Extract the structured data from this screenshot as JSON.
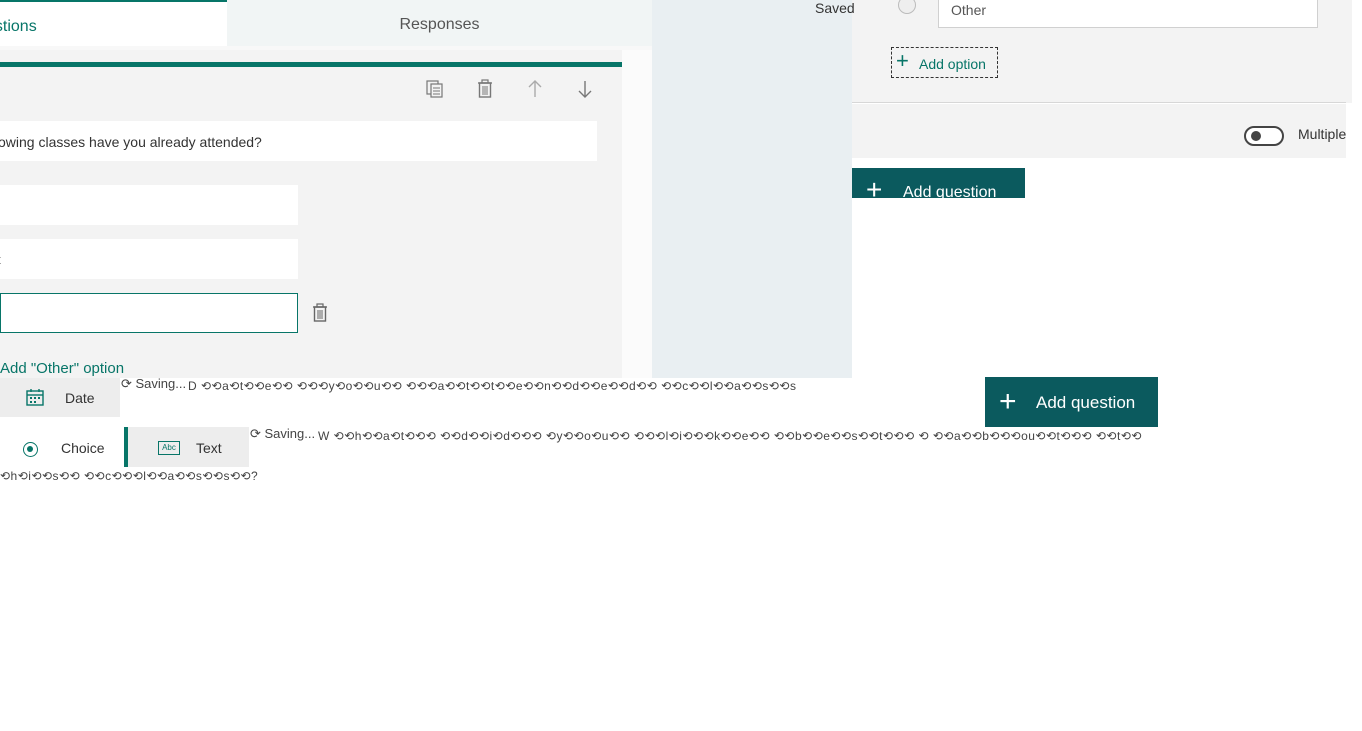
{
  "tabs": {
    "questions": "estions",
    "responses": "Responses"
  },
  "question": {
    "title": "owing classes have you already attended?",
    "option_2_text": "t",
    "add_other_label": "Add \"Other\" option"
  },
  "right_panel": {
    "saved_label": "Saved",
    "other_field_text": "Other",
    "add_option_label": "Add option",
    "multiple_answers_label": "Multiple",
    "add_question_label": "Add question"
  },
  "question_types": {
    "date_label": "Date",
    "choice_label": "Choice",
    "text_label": "Text",
    "text_icon_label": "Abc"
  },
  "saving_status": {
    "saving_1": "Saving...",
    "saving_2": "Saving..."
  },
  "garbled_text": {
    "line_1": "D ⟲⟲a⟲t⟲⟲e⟲⟲ ⟲⟲⟲y⟲o⟲⟲u⟲⟲ ⟲⟲⟲a⟲⟲t⟲⟲t⟲⟲e⟲⟲n⟲⟲d⟲⟲e⟲⟲d⟲⟲ ⟲⟲c⟲⟲l⟲⟲a⟲⟲s⟲⟲s",
    "line_2": "W ⟲⟲h⟲⟲a⟲t⟲⟲⟲ ⟲⟲d⟲⟲i⟲d⟲⟲⟲ ⟲y⟲⟲o⟲u⟲⟲ ⟲⟲⟲l⟲i⟲⟲⟲k⟲⟲e⟲⟲ ⟲⟲b⟲⟲e⟲⟲s⟲⟲t⟲⟲⟲ ⟲ ⟲⟲a⟲⟲b⟲⟲⟲ou⟲⟲t⟲⟲⟲ ⟲⟲t⟲⟲",
    "line_3": "⟲h⟲i⟲⟲s⟲⟲ ⟲⟲c⟲⟲⟲l⟲⟲a⟲⟲s⟲⟲s⟲⟲?"
  },
  "colors": {
    "accent": "#077568",
    "button_dark": "#0b5a5e",
    "panel_bg": "#f3f3f3"
  }
}
